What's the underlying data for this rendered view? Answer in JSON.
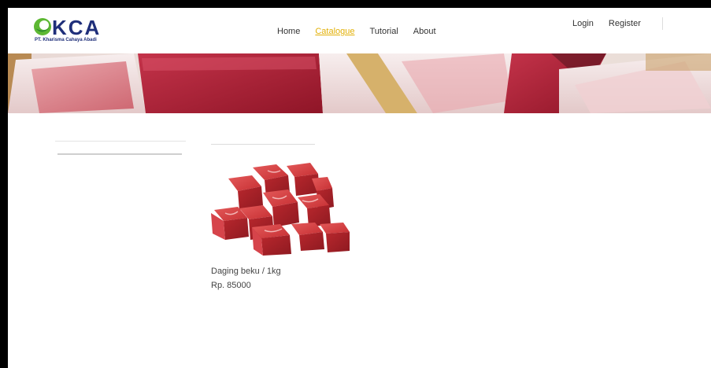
{
  "brand": {
    "logo_text": "KCA",
    "logo_subtitle": "PT. Kharisma Cahaya Abadi",
    "colors": {
      "primary": "#1f2f7a",
      "accent": "#e2b007",
      "logo_green": "#5db833"
    }
  },
  "nav": {
    "items": [
      {
        "label": "Home",
        "active": false
      },
      {
        "label": "Catalogue",
        "active": true
      },
      {
        "label": "Tutorial",
        "active": false
      },
      {
        "label": "About",
        "active": false
      }
    ]
  },
  "auth": {
    "login_label": "Login",
    "register_label": "Register"
  },
  "products": [
    {
      "name": "Daging beku / 1kg",
      "price": "Rp. 85000",
      "image_icon": "frozen-meat-cubes-image"
    }
  ]
}
